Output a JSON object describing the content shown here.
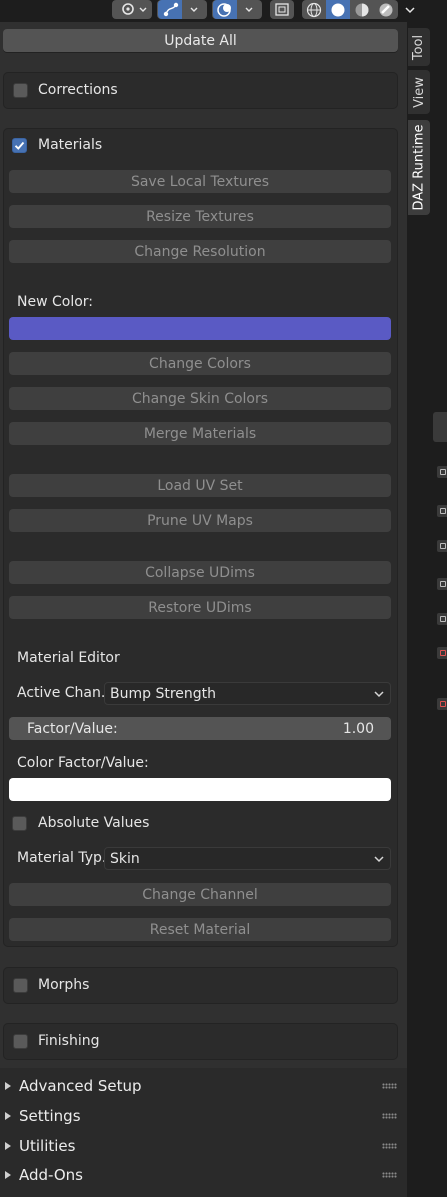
{
  "header_tools": {
    "shading_modes": [
      "wireframe",
      "solid",
      "material",
      "rendered"
    ],
    "active_shading": "solid"
  },
  "panel": {
    "update_all": "Update All",
    "corrections": {
      "label": "Corrections",
      "checked": false
    },
    "materials": {
      "label": "Materials",
      "checked": true,
      "buttons": {
        "save_local_textures": "Save Local Textures",
        "resize_textures": "Resize Textures",
        "change_resolution": "Change Resolution",
        "change_colors": "Change Colors",
        "change_skin_colors": "Change Skin Colors",
        "merge_materials": "Merge Materials",
        "load_uv_set": "Load UV Set",
        "prune_uv_maps": "Prune UV Maps",
        "collapse_udims": "Collapse UDims",
        "restore_udims": "Restore UDims",
        "change_channel": "Change Channel",
        "reset_material": "Reset Material"
      },
      "new_color_label": "New Color:",
      "new_color": "#5a5ac4",
      "material_editor": "Material Editor",
      "active_channel_label": "Active Chan..",
      "active_channel_value": "Bump Strength",
      "factor_label": "Factor/Value:",
      "factor_value": "1.00",
      "color_factor_label": "Color Factor/Value:",
      "color_factor": "#ffffff",
      "absolute_values": {
        "label": "Absolute Values",
        "checked": false
      },
      "material_type_label": "Material Typ..",
      "material_type_value": "Skin"
    },
    "morphs": {
      "label": "Morphs",
      "checked": false
    },
    "finishing": {
      "label": "Finishing",
      "checked": false
    },
    "collapsed_sections": [
      "Advanced Setup",
      "Settings",
      "Utilities",
      "Add-Ons"
    ]
  },
  "tabs": [
    "Tool",
    "View",
    "DAZ Runtime"
  ],
  "active_tab": "DAZ Runtime",
  "colors": {
    "accent": "#4772b3",
    "panel_bg": "#303030",
    "box_bg": "#2b2b2b",
    "button": "#545454",
    "button_disabled": "#3f3f3f"
  }
}
